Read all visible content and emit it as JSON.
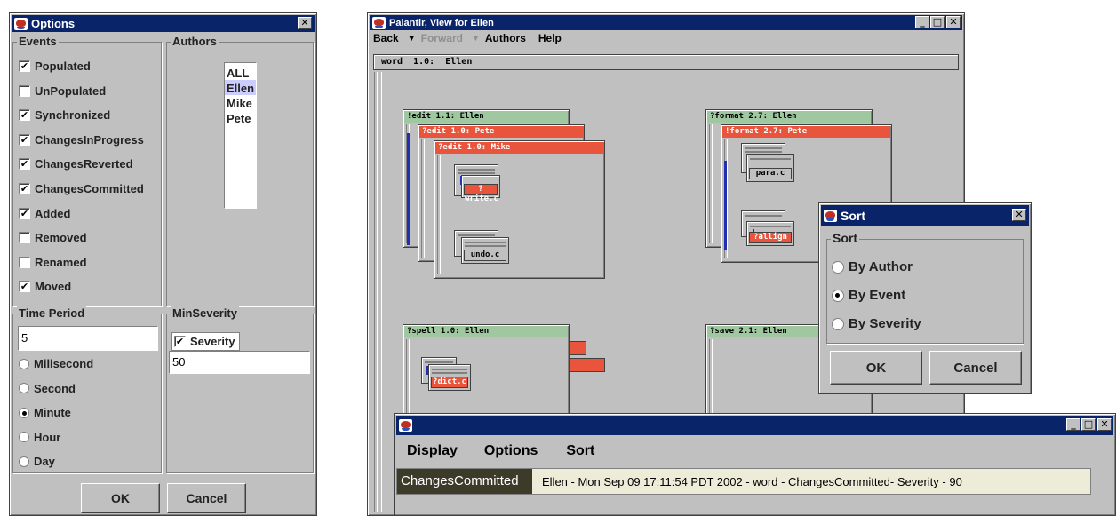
{
  "options": {
    "title": "Options",
    "close": "✕",
    "events": {
      "title": "Events",
      "items": [
        {
          "label": "Populated",
          "checked": true
        },
        {
          "label": "UnPopulated",
          "checked": false
        },
        {
          "label": "Synchronized",
          "checked": true
        },
        {
          "label": "ChangesInProgress",
          "checked": true
        },
        {
          "label": "ChangesReverted",
          "checked": true
        },
        {
          "label": "ChangesCommitted",
          "checked": true
        },
        {
          "label": "Added",
          "checked": true
        },
        {
          "label": "Removed",
          "checked": false
        },
        {
          "label": "Renamed",
          "checked": false
        },
        {
          "label": "Moved",
          "checked": true
        }
      ]
    },
    "authors": {
      "title": "Authors",
      "items": [
        "ALL",
        "Ellen",
        "Mike",
        "Pete"
      ],
      "selected": "Ellen"
    },
    "time_period": {
      "title": "Time Period",
      "value": "5",
      "options": [
        "Milisecond",
        "Second",
        "Minute",
        "Hour",
        "Day"
      ],
      "selected": "Minute"
    },
    "min_severity": {
      "title": "MinSeverity",
      "check_label": "Severity",
      "checked": true,
      "value": "50"
    },
    "ok": "OK",
    "cancel": "Cancel"
  },
  "palantir": {
    "title": "Palantir, View for Ellen",
    "menu": {
      "back": "Back",
      "forward": "Forward",
      "authors": "Authors",
      "help": "Help"
    },
    "root_label": "word  1.0:  Ellen",
    "nodes": {
      "edit_ellen": "!edit 1.1: Ellen",
      "edit_pete": "?edit 1.0: Pete",
      "edit_mike": "?edit 1.0: Mike",
      "write": "?write.c",
      "undo": "undo.c",
      "format_ellen": "?format 2.7: Ellen",
      "format_pete": "!format 2.7: Pete",
      "para": "para.c",
      "allign": "?allign",
      "spell_ellen": "?spell 1.0: Ellen",
      "dict": "?dict.c",
      "save_ellen": "?save 2.1: Ellen"
    }
  },
  "sort": {
    "title": "Sort",
    "group": "Sort",
    "options": [
      "By Author",
      "By Event",
      "By Severity"
    ],
    "selected": "By Event",
    "ok": "OK",
    "cancel": "Cancel"
  },
  "events_window": {
    "menu": [
      "Display",
      "Options",
      "Sort"
    ],
    "event_type": "ChangesCommitted",
    "message": "Ellen - Mon Sep 09 17:11:54 PDT 2002 - word - ChangesCommitted- Severity  - 90"
  },
  "colors": {
    "titlebar": "#0a246a",
    "conflict": "#e8553c",
    "ok_state": "#9fc8a0",
    "selection": "#ccccff",
    "event_tag": "#3c3a28"
  }
}
